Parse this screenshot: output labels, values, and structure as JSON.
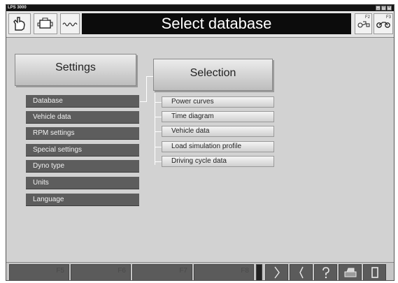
{
  "titlebar": {
    "app_name": "LPS 3000"
  },
  "header": {
    "title": "Select database",
    "icons": [
      "gloved-hand-icon",
      "engine-icon",
      "wave-signal-icon"
    ],
    "right_buttons": [
      {
        "key": "F2",
        "icon": "chassis-dyno-icon"
      },
      {
        "key": "F3",
        "icon": "motorcycle-icon"
      }
    ]
  },
  "settings": {
    "title": "Settings",
    "items": [
      "Database",
      "Vehicle data",
      "RPM settings",
      "Special settings",
      "Dyno type",
      "Units",
      "Language"
    ]
  },
  "selection": {
    "title": "Selection",
    "items": [
      "Power curves",
      "Time diagram",
      "Vehicle data",
      "Load simulation profile",
      "Driving cycle data"
    ]
  },
  "footer": {
    "fkeys": [
      "F5",
      "F6",
      "F7",
      "F8"
    ],
    "icons": [
      "separator-icon",
      "arrow-up-icon",
      "arrow-down-icon",
      "help-icon",
      "printer-icon",
      "exit-door-icon"
    ]
  },
  "colors": {
    "accent_dark": "#0c0c0c",
    "menu_bg": "#5d5d5d",
    "panel_bg": "#d2d2d2"
  }
}
